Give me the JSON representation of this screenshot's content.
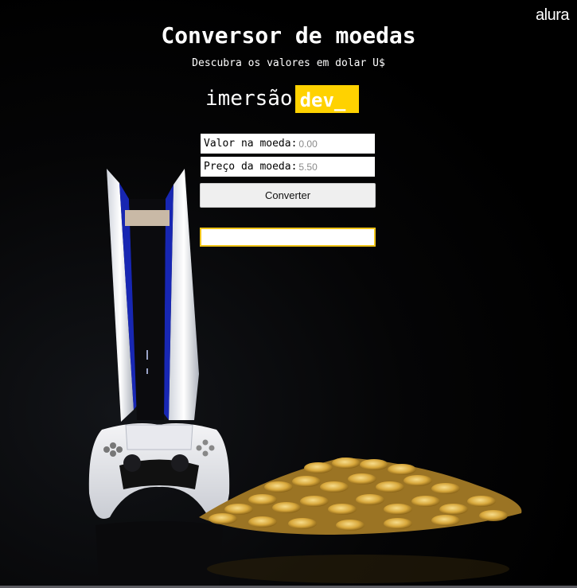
{
  "brand": {
    "name": "alura"
  },
  "header": {
    "title": "Conversor de moedas",
    "subtitle": "Descubra os valores em dolar U$"
  },
  "logo": {
    "text": "imersão",
    "badge": "dev_",
    "badge_color": "#ffd200"
  },
  "form": {
    "amount": {
      "label": "Valor na moeda:",
      "placeholder": "0.00"
    },
    "rate": {
      "label": "Preço da moeda:",
      "placeholder": "5.50"
    },
    "convert_label": "Converter",
    "result_value": ""
  },
  "colors": {
    "background": "#000000",
    "result_border": "#f0c419"
  }
}
